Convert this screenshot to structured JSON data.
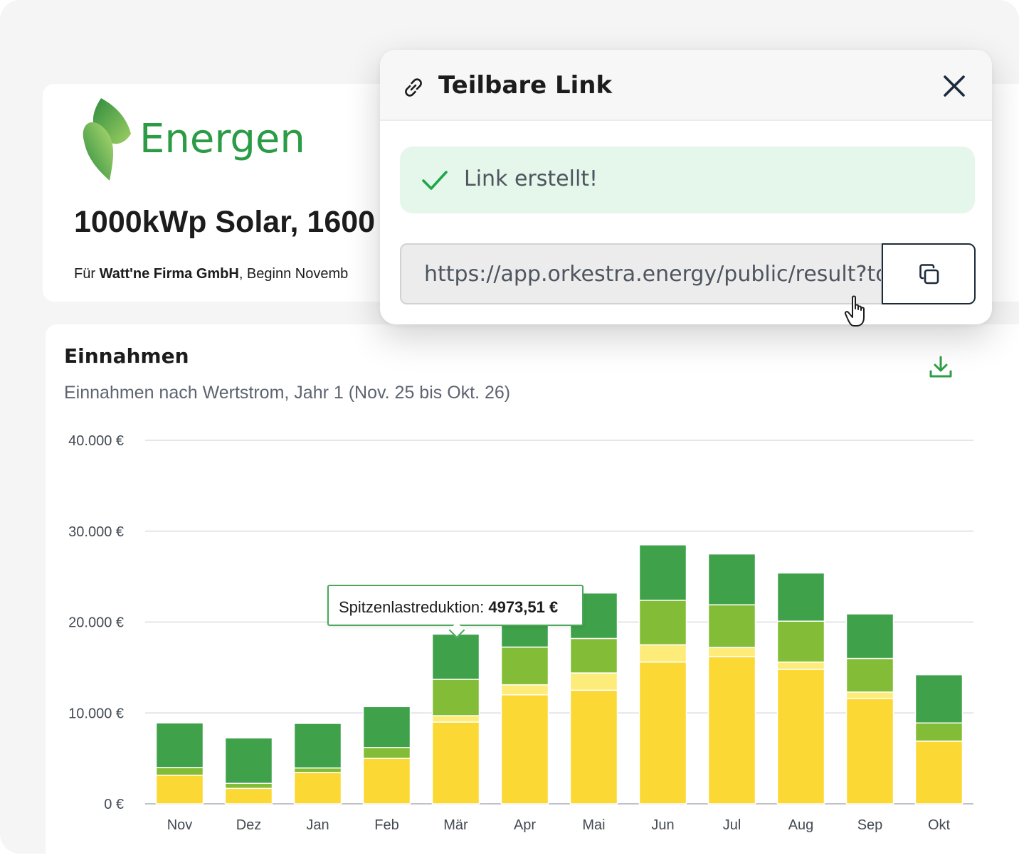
{
  "brand": {
    "name": "Energen",
    "color": "#2c9b45"
  },
  "project": {
    "title": "1000kWp Solar, 1600",
    "subtitle_prefix": "Für ",
    "company": "Watt'ne Firma GmbH",
    "subtitle_suffix": ", Beginn Novemb"
  },
  "modal": {
    "title": "Teilbare Link",
    "link_icon": "link-icon",
    "close_icon": "close-icon",
    "success_text": "Link erstellt!",
    "success_icon": "check-icon",
    "url_value": "https://app.orkestra.energy/public/result?tol",
    "copy_icon": "copy-icon"
  },
  "chart_card": {
    "title": "Einnahmen",
    "subtitle": "Einnahmen nach Wertstrom, Jahr 1 (Nov. 25 bis Okt. 26)",
    "download_icon": "download-icon"
  },
  "tooltip": {
    "label": "Spitzenlastreduktion: ",
    "value": "4973,51 €"
  },
  "chart_data": {
    "type": "bar",
    "stacked": true,
    "categories": [
      "Nov",
      "Dez",
      "Jan",
      "Feb",
      "Mär",
      "Apr",
      "Mai",
      "Jun",
      "Jul",
      "Aug",
      "Sep",
      "Okt"
    ],
    "y_ticks": [
      0,
      10000,
      20000,
      30000,
      40000
    ],
    "y_tick_labels": [
      "0 €",
      "10.000 €",
      "20.000 €",
      "30.000 €",
      "40.000 €"
    ],
    "ylim": [
      0,
      40000
    ],
    "grid": true,
    "series": [
      {
        "color": "#fcd834",
        "values": [
          3150,
          1700,
          3450,
          5000,
          9000,
          12000,
          12500,
          15600,
          16200,
          14800,
          11600,
          6900
        ]
      },
      {
        "color": "#fdeb7a",
        "values": [
          0,
          0,
          0,
          0,
          700,
          1100,
          1900,
          1900,
          1000,
          800,
          700,
          0
        ]
      },
      {
        "color": "#83bd37",
        "values": [
          850,
          550,
          500,
          1200,
          4000,
          4150,
          3800,
          4900,
          4700,
          4500,
          3700,
          2000
        ]
      },
      {
        "color": "#3fa14a",
        "values": [
          4900,
          5000,
          4900,
          4500,
          4973.51,
          4000,
          5000,
          6100,
          5600,
          5300,
          4900,
          5300
        ]
      }
    ]
  }
}
